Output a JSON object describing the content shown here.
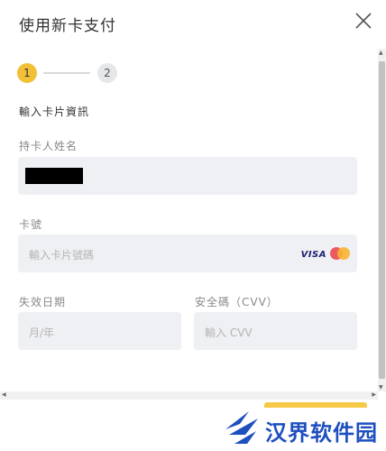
{
  "dialog": {
    "title": "使用新卡支付",
    "close_icon": "close-icon"
  },
  "stepper": {
    "steps": [
      {
        "number": "1",
        "active": true
      },
      {
        "number": "2",
        "active": false
      }
    ]
  },
  "form": {
    "section_title": "輸入卡片資訊",
    "cardholder": {
      "label": "持卡人姓名",
      "value": ""
    },
    "card_number": {
      "label": "卡號",
      "placeholder": "輸入卡片號碼",
      "brands": [
        "VISA",
        "mastercard-icon"
      ]
    },
    "expiry": {
      "label": "失效日期",
      "placeholder": "月/年"
    },
    "cvv": {
      "label": "安全碼（CVV）",
      "placeholder": "輸入 CVV"
    }
  },
  "watermark": {
    "text": "汉界软件园"
  },
  "colors": {
    "accent": "#f2c037",
    "field_bg": "#eff0f3",
    "watermark": "#1e4fbf"
  }
}
